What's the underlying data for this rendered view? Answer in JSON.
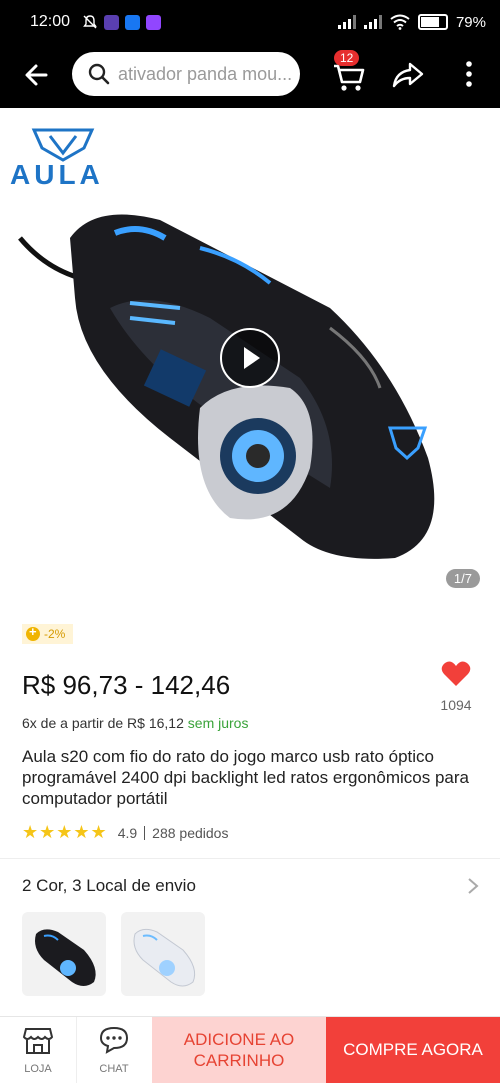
{
  "status_bar": {
    "time": "12:00",
    "battery": "79%"
  },
  "header": {
    "search_placeholder": "ativador panda mou...",
    "cart_count": "12"
  },
  "gallery": {
    "counter": "1/7",
    "brand_logo_text": "AULA"
  },
  "product": {
    "discount_badge": "-2%",
    "price": "R$ 96,73 - 142,46",
    "wishlist_count": "1094",
    "installments_prefix": "6x de a partir de R$ 16,12",
    "installments_free": "sem juros",
    "title": "Aula s20 com fio do rato do jogo marco usb rato óptico programável 2400 dpi backlight led ratos ergonômicos para computador portátil",
    "rating": "4.9",
    "orders": "288 pedidos",
    "variants_summary": "2 Cor, 3 Local de envio"
  },
  "bottom_bar": {
    "store_label": "LOJA",
    "chat_label": "CHAT",
    "add_to_cart_label": "ADICIONE AO CARRINHO",
    "buy_now_label": "COMPRE AGORA"
  },
  "colors": {
    "accent_red": "#f2403a",
    "add_cart_bg": "#fdd3d1",
    "free_green": "#3aa33a",
    "star_yellow": "#f5c518"
  }
}
